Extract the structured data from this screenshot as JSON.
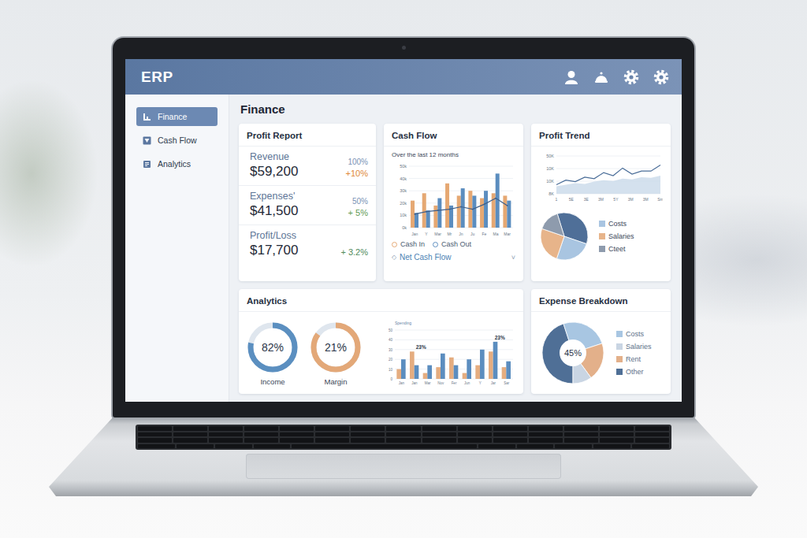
{
  "app": {
    "title": "ERP"
  },
  "sidebar": {
    "items": [
      {
        "label": "Finance",
        "selected": true
      },
      {
        "label": "Cash Flow",
        "selected": false
      },
      {
        "label": "Analytics",
        "selected": false
      }
    ]
  },
  "page": {
    "title": "Finance"
  },
  "profit_report": {
    "title": "Profit Report",
    "rows": [
      {
        "label": "Revenue",
        "value": "$59,200",
        "share": "100%",
        "change": "+10%",
        "color": "#e0883a"
      },
      {
        "label": "Expenses'",
        "value": "$41,500",
        "share": "50%",
        "change": "+ 5%",
        "color": "#5f9a55"
      },
      {
        "label": "Profit/Loss",
        "value": "$17,700",
        "change": "+ 3.2%",
        "color": "#4f8a5b"
      }
    ]
  },
  "cash_flow": {
    "title": "Cash Flow",
    "subtitle": "Over the last 12 months",
    "y_ticks": [
      "50k",
      "40k",
      "30k",
      "20k",
      "10k",
      "0k"
    ],
    "x_labels": [
      "Jan",
      "Y",
      "Mar",
      "Mr",
      "Jn",
      "Ju",
      "Fe",
      "Ma",
      "Mar"
    ],
    "cash_in": [
      22,
      28,
      18,
      36,
      26,
      30,
      24,
      28,
      26
    ],
    "cash_out": [
      12,
      14,
      24,
      18,
      32,
      26,
      30,
      44,
      22
    ],
    "net": [
      11,
      13,
      14,
      15,
      17,
      15,
      19,
      24,
      18
    ],
    "legend": [
      {
        "label": "Cash In",
        "color": "#e5a873"
      },
      {
        "label": "Cash Out",
        "color": "#5b8dbf"
      }
    ],
    "net_flow": {
      "icon": "◇",
      "label": "Net Cash Flow",
      "menu_icon": "˅"
    }
  },
  "profit_trend": {
    "title": "Profit Trend",
    "y_ticks": [
      "50K",
      "10K",
      "10K",
      "8K"
    ],
    "x_labels": [
      "1",
      "5E",
      "3E",
      "3M",
      "5Y",
      "3M",
      "3M",
      "Sm"
    ],
    "line": [
      12,
      18,
      16,
      22,
      20,
      28,
      24,
      34,
      26,
      30,
      30,
      38
    ],
    "area": [
      10,
      12,
      14,
      13,
      16,
      18,
      17,
      20,
      19,
      22,
      21,
      24
    ],
    "pie": {
      "slices": [
        {
          "value": 35,
          "color": "#4f6f98"
        },
        {
          "value": 25,
          "color": "#a9c5e1"
        },
        {
          "value": 25,
          "color": "#e7b48a"
        },
        {
          "value": 15,
          "color": "#8e9bad"
        }
      ]
    },
    "legend": [
      {
        "label": "Costs",
        "color": "#a9c5e1"
      },
      {
        "label": "Salaries",
        "color": "#e7b48a"
      },
      {
        "label": "Cteet",
        "color": "#8e9bad"
      }
    ]
  },
  "analytics": {
    "title": "Analytics",
    "rings": [
      {
        "value": "82%",
        "label": "Income",
        "level": 0.78,
        "color": "#5b8fc0"
      },
      {
        "value": "21%",
        "label": "Margin",
        "level": 0.85,
        "color": "#e3a878"
      }
    ],
    "chart": {
      "caption": "Spending",
      "y_ticks": [
        "50",
        "40",
        "30",
        "20",
        "10",
        "0"
      ],
      "groups": [
        {
          "label": "Jan",
          "a": 10,
          "b": 20
        },
        {
          "label": "Jan",
          "a": 28,
          "b": 14,
          "note": "23%"
        },
        {
          "label": "Mar",
          "a": 6,
          "b": 14
        },
        {
          "label": "Nov",
          "a": 12,
          "b": 26
        },
        {
          "label": "Fer",
          "a": 22,
          "b": 14
        },
        {
          "label": "Jun",
          "a": 6,
          "b": 20
        },
        {
          "label": "Y",
          "a": 14,
          "b": 30
        },
        {
          "label": "Jar",
          "a": 28,
          "b": 38,
          "note": "23%"
        },
        {
          "label": "Sar",
          "a": 12,
          "b": 18
        }
      ]
    }
  },
  "expense_breakdown": {
    "title": "Expense Breakdown",
    "center": "45%",
    "items": [
      {
        "label": "Costs",
        "value": 25,
        "color": "#a8c6e2"
      },
      {
        "label": "Salaries",
        "value": 10,
        "color": "#c9d5e3"
      },
      {
        "label": "Rent",
        "value": 20,
        "color": "#e3b08a"
      },
      {
        "label": "Other",
        "value": 45,
        "color": "#4f6f96"
      }
    ]
  }
}
